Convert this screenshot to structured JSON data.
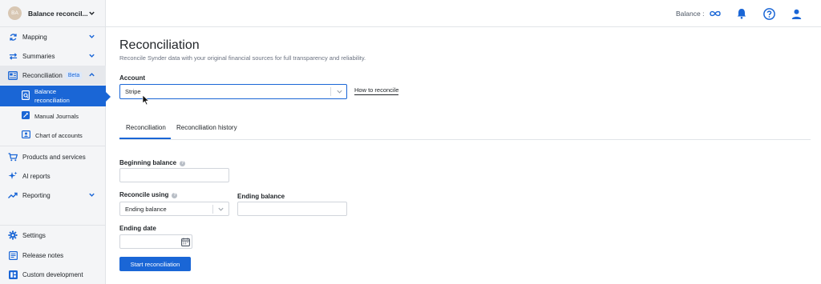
{
  "org": {
    "initials": "BA",
    "name": "Balance reconcil..."
  },
  "sidebar": {
    "items": [
      {
        "label": "Mapping",
        "icon": "sync-icon"
      },
      {
        "label": "Summaries",
        "icon": "arrows-swap-icon"
      },
      {
        "label": "Reconciliation",
        "badge": "Beta",
        "icon": "reconcile-icon"
      },
      {
        "label": "Products and services",
        "icon": "cart-icon"
      },
      {
        "label": "AI reports",
        "icon": "sparkle-icon"
      },
      {
        "label": "Reporting",
        "icon": "trend-icon"
      },
      {
        "label": "Settings",
        "icon": "gear-icon"
      },
      {
        "label": "Release notes",
        "icon": "notes-icon"
      },
      {
        "label": "Custom development",
        "icon": "dev-icon"
      }
    ],
    "sub_items": [
      {
        "label": "Balance reconciliation",
        "icon": "balance-doc-icon"
      },
      {
        "label": "Manual Journals",
        "icon": "pencil-icon"
      },
      {
        "label": "Chart of accounts",
        "icon": "contact-card-icon"
      }
    ]
  },
  "topbar": {
    "balance_label": "Balance :"
  },
  "page": {
    "title": "Reconciliation",
    "subtitle": "Reconcile Synder data with your original financial sources for full transparency and reliability."
  },
  "account": {
    "label": "Account",
    "value": "Stripe",
    "how_to": "How to reconcile"
  },
  "tabs": [
    {
      "label": "Reconciliation",
      "active": true
    },
    {
      "label": "Reconciliation history",
      "active": false
    }
  ],
  "form": {
    "beginning_balance_label": "Beginning balance",
    "beginning_balance_value": "",
    "reconcile_using_label": "Reconcile using",
    "reconcile_using_value": "Ending balance",
    "ending_balance_label": "Ending balance",
    "ending_balance_value": "",
    "ending_date_label": "Ending date",
    "ending_date_value": "",
    "submit_label": "Start reconciliation"
  },
  "colors": {
    "accent": "#1a66d6",
    "sidebar_bg": "#f4f5f7",
    "badge_bg": "#dbe8fb"
  }
}
